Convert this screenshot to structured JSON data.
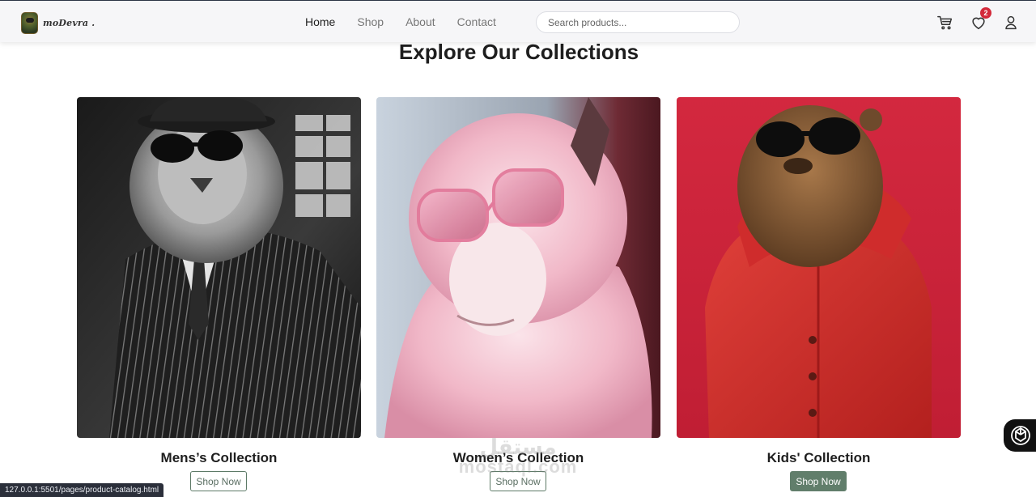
{
  "brand": {
    "name": "moDevra ."
  },
  "nav": {
    "links": [
      "Home",
      "Shop",
      "About",
      "Contact"
    ],
    "active": "Home"
  },
  "search": {
    "placeholder": "Search products..."
  },
  "header_icons": {
    "cart": "cart-icon",
    "wishlist": "heart-icon",
    "account": "user-icon",
    "wishlist_count": "2"
  },
  "section": {
    "title": "Explore Our Collections"
  },
  "collections": [
    {
      "title": "Mens’s Collection",
      "button": "Shop Now",
      "button_style": "outline"
    },
    {
      "title": "Women’s Collection",
      "button": "Shop Now",
      "button_style": "outline"
    },
    {
      "title": "Kids' Collection",
      "button": "Shop Now",
      "button_style": "filled"
    }
  ],
  "watermark": {
    "arabic": "مستقل",
    "latin": "mostaql.com"
  },
  "status_bar": {
    "url": "127.0.0.1:5501/pages/product-catalog.html"
  },
  "colors": {
    "accent": "#617e6b",
    "badge": "#d3293a",
    "nav_bg": "#f6f6f8"
  }
}
